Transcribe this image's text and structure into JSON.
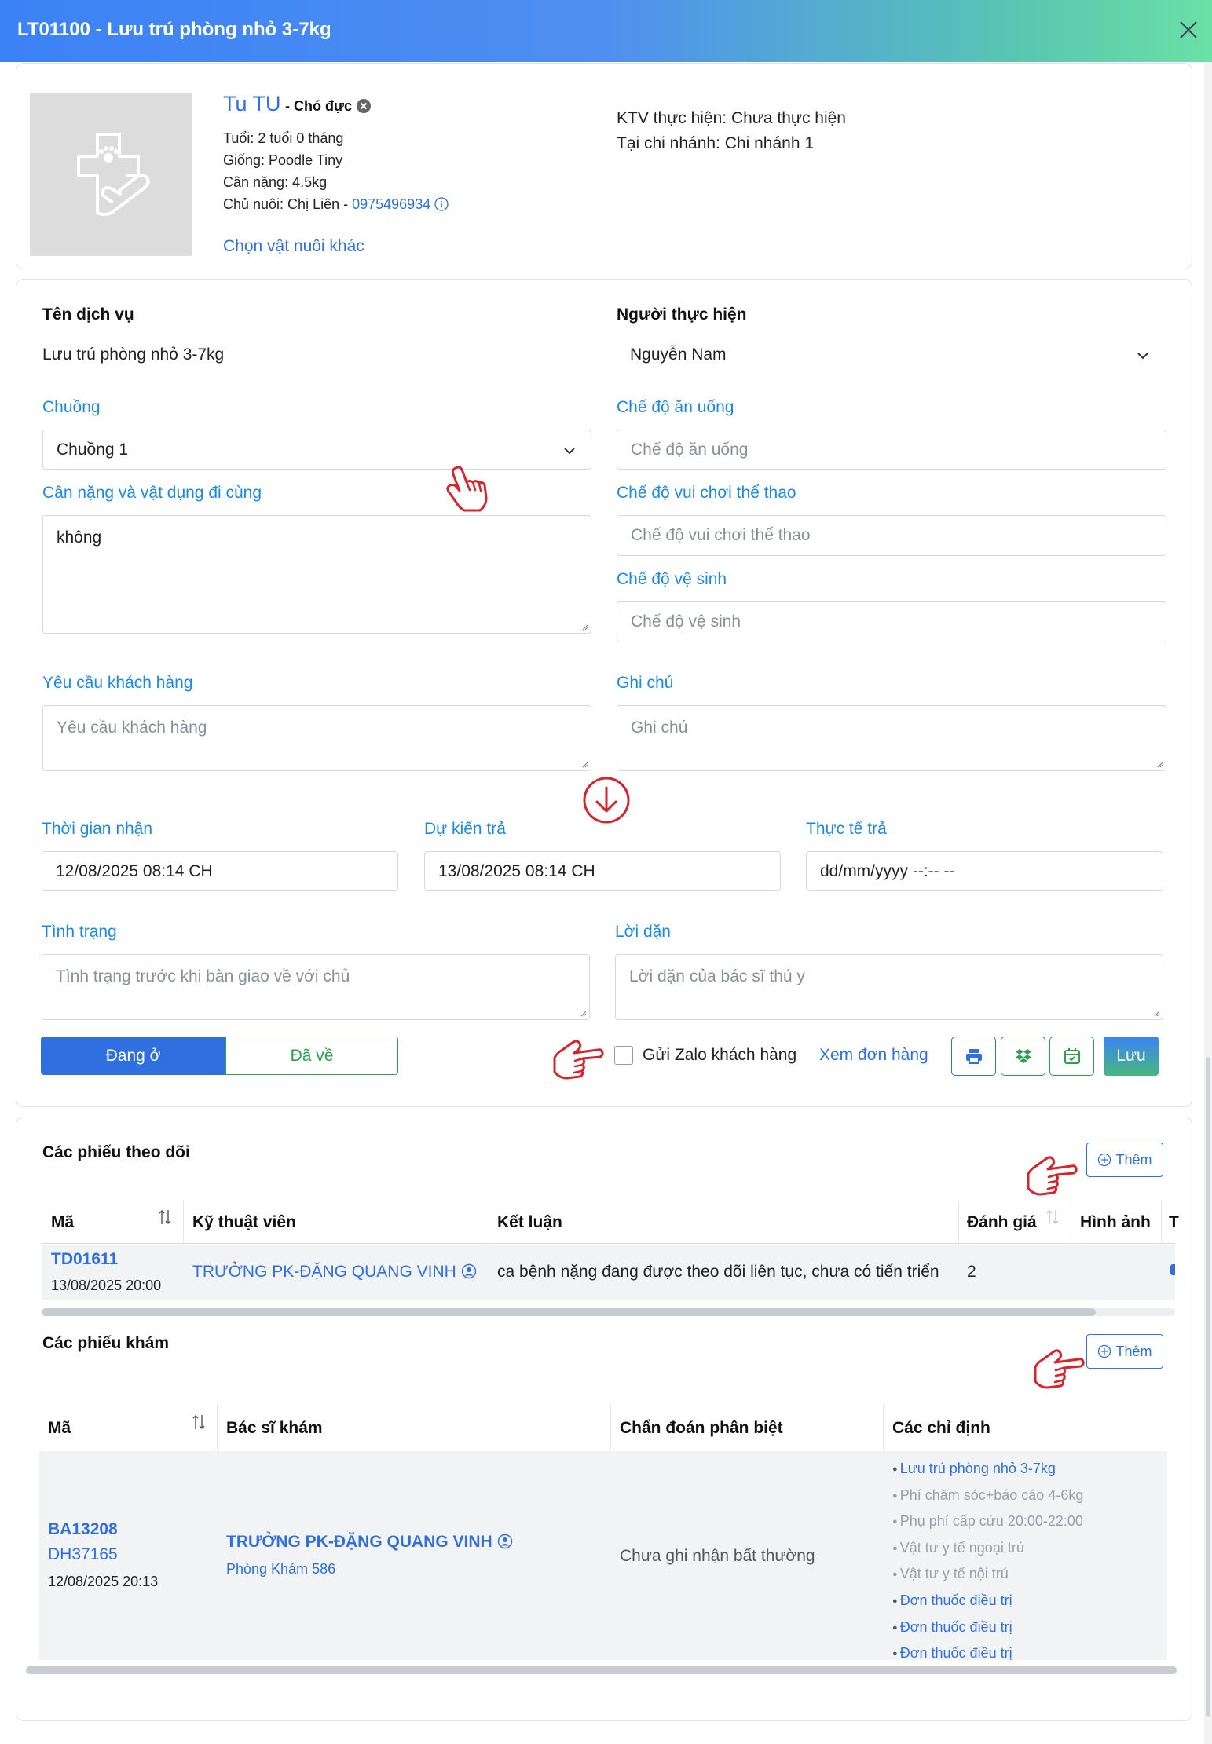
{
  "window": {
    "title": "LT01100 - Lưu trú phòng nhỏ 3-7kg"
  },
  "pet": {
    "name": "Tu TU",
    "type": "- Chó đực",
    "age": "Tuổi: 2 tuổi 0 tháng",
    "breed": "Giống: Poodle Tiny",
    "weight": "Cân nặng: 4.5kg",
    "owner_prefix": "Chủ nuôi: Chị Liên -",
    "owner_phone": "0975496934",
    "change_link": "Chọn vật nuôi khác",
    "ktv": "KTV thực hiện: Chưa thực hiện",
    "branch": "Tại chi nhánh: Chi nhánh 1"
  },
  "service": {
    "name_label": "Tên dịch vụ",
    "name_value": "Lưu trú phòng nhỏ 3-7kg",
    "performer_label": "Người thực hiện",
    "performer_value": "Nguyễn Nam"
  },
  "form": {
    "cage_label": "Chuồng",
    "cage_value": "Chuồng 1",
    "diet_label": "Chế độ ăn uống",
    "diet_placeholder": "Chế độ ăn uống",
    "weight_items_label": "Cân nặng và vật dụng đi cùng",
    "weight_items_value": "không",
    "play_label": "Chế độ vui chơi thể thao",
    "play_placeholder": "Chế độ vui chơi thể thao",
    "hygiene_label": "Chế độ vệ sinh",
    "hygiene_placeholder": "Chế độ vệ sinh",
    "request_label": "Yêu cầu khách hàng",
    "request_placeholder": "Yêu cầu khách hàng",
    "note_label": "Ghi chú",
    "note_placeholder": "Ghi chú",
    "receive_label": "Thời gian nhận",
    "receive_value": "12/08/2025 08:14  CH",
    "expected_label": "Dự kiến trả",
    "expected_value": "13/08/2025 08:14  CH",
    "actual_label": "Thực tế trả",
    "actual_value": "dd/mm/yyyy --:-- --",
    "status_label": "Tình trạng",
    "status_placeholder": "Tình trạng trước khi bàn giao về với chủ",
    "advice_label": "Lời dặn",
    "advice_placeholder": "Lời dặn của bác sĩ thú y",
    "staying_btn": "Đang ở",
    "returned_btn": "Đã về",
    "zalo_label": "Gửi Zalo khách hàng",
    "view_order": "Xem đơn hàng",
    "save_btn": "Lưu"
  },
  "tracking": {
    "title": "Các phiếu theo dõi",
    "add_btn": "Thêm",
    "headers": [
      "Mã",
      "Kỹ thuật viên",
      "Kết luận",
      "Đánh giá",
      "Hình ảnh",
      "T"
    ],
    "rows": [
      {
        "code": "TD01611",
        "date": "13/08/2025 20:00",
        "tech": "TRƯỞNG PK-ĐẶNG QUANG VINH",
        "conclusion": "ca bệnh nặng đang được theo dõi liên tục, chưa có tiến triển",
        "rating": "2"
      }
    ]
  },
  "exams": {
    "title": "Các phiếu khám",
    "add_btn": "Thêm",
    "headers": [
      "Mã",
      "Bác sĩ khám",
      "Chẩn đoán phân biệt",
      "Các chỉ định"
    ],
    "rows": [
      {
        "code": "BA13208",
        "order": "DH37165",
        "date": "12/08/2025 20:13",
        "doctor": "TRƯỞNG PK-ĐẶNG QUANG VINH",
        "clinic": "Phòng Khám 586",
        "diagnosis": "Chưa ghi nhận bất thường",
        "orders": [
          {
            "text": "Lưu trú phòng nhỏ 3-7kg",
            "active": true
          },
          {
            "text": "Phí chăm sóc+báo cáo 4-6kg",
            "active": false
          },
          {
            "text": "Phụ phí cấp cứu 20:00-22:00",
            "active": false
          },
          {
            "text": "Vật tư y tế ngoại trú",
            "active": false
          },
          {
            "text": "Vật tư y tế nội trú",
            "active": false
          },
          {
            "text": "Đơn thuốc điều trị",
            "active": true
          },
          {
            "text": "Đơn thuốc điều trị",
            "active": true
          },
          {
            "text": "Đơn thuốc điều trị",
            "active": true
          }
        ]
      }
    ]
  },
  "colors": {
    "accent": "#1e88e5",
    "link": "#2f6fe0",
    "success": "#2e9e4f",
    "annotation": "#d9232a"
  },
  "icons": [
    "close-icon",
    "pet-care-icon",
    "info-icon",
    "remove-icon",
    "chevron-down-icon",
    "hand-pointer-icon",
    "arrow-down-circle-icon",
    "print-icon",
    "dropbox-icon",
    "calendar-icon",
    "plus-circle-icon",
    "sort-icon",
    "user-circle-icon"
  ]
}
